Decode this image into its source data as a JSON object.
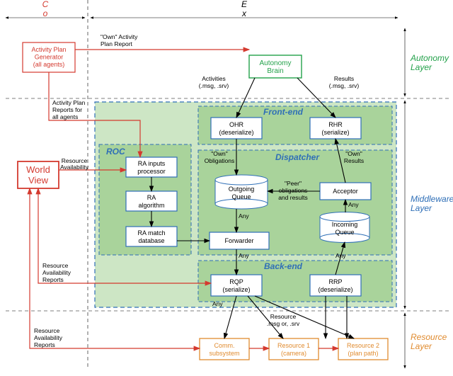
{
  "planes": {
    "control": "Control\nPlane",
    "execution": "Execution\nPlane"
  },
  "layers": {
    "autonomy": "Autonomy\nLayer",
    "middleware": "Middleware\nLayer",
    "resource": "Resource\nLayer"
  },
  "regions": {
    "front": "Front-end",
    "dispatcher": "Dispatcher",
    "back": "Back-end",
    "roc": "ROC"
  },
  "blocks": {
    "apg": "Activity Plan\nGenerator\n(all agents)",
    "worldview": "World\nView",
    "brain": "Autonomy\nBrain",
    "ohr": "OHR\n(deserialize)",
    "rhr": "RHR\n(serialize)",
    "ra_in": "RA inputs\nprocessor",
    "ra_alg": "RA\nalgorithm",
    "ra_db": "RA match\ndatabase",
    "outq": "Outgoing\nQueue",
    "inq": "Incoming\nQueue",
    "acceptor": "Acceptor",
    "forwarder": "Forwarder",
    "rqp": "RQP\n(serialize)",
    "rrp": "RRP\n(deserialize)",
    "comm": "Comm.\nsubsystem",
    "res1": "Resource 1\n(camera)",
    "res2": "Resource 2\n(plan path)"
  },
  "edges": {
    "own_plan": "\"Own\" Activity\nPlan Report",
    "activities": "Activities\n(.msg, .srv)",
    "results": "Results\n(.msg, .srv)",
    "plan_all": "Activity Plan\nReports for\nall agents",
    "res_avail": "Resource\nAvailability",
    "own_oblig": "\"Own\"\nObligations",
    "own_res": "\"Own\"\nResults",
    "peer": "\"Peer\"\nobligations\nand results",
    "any": "Any",
    "res_avail_rep": "Resource\nAvailability\nReports",
    "res_msg": "Resource\n.msg or, .srv"
  }
}
